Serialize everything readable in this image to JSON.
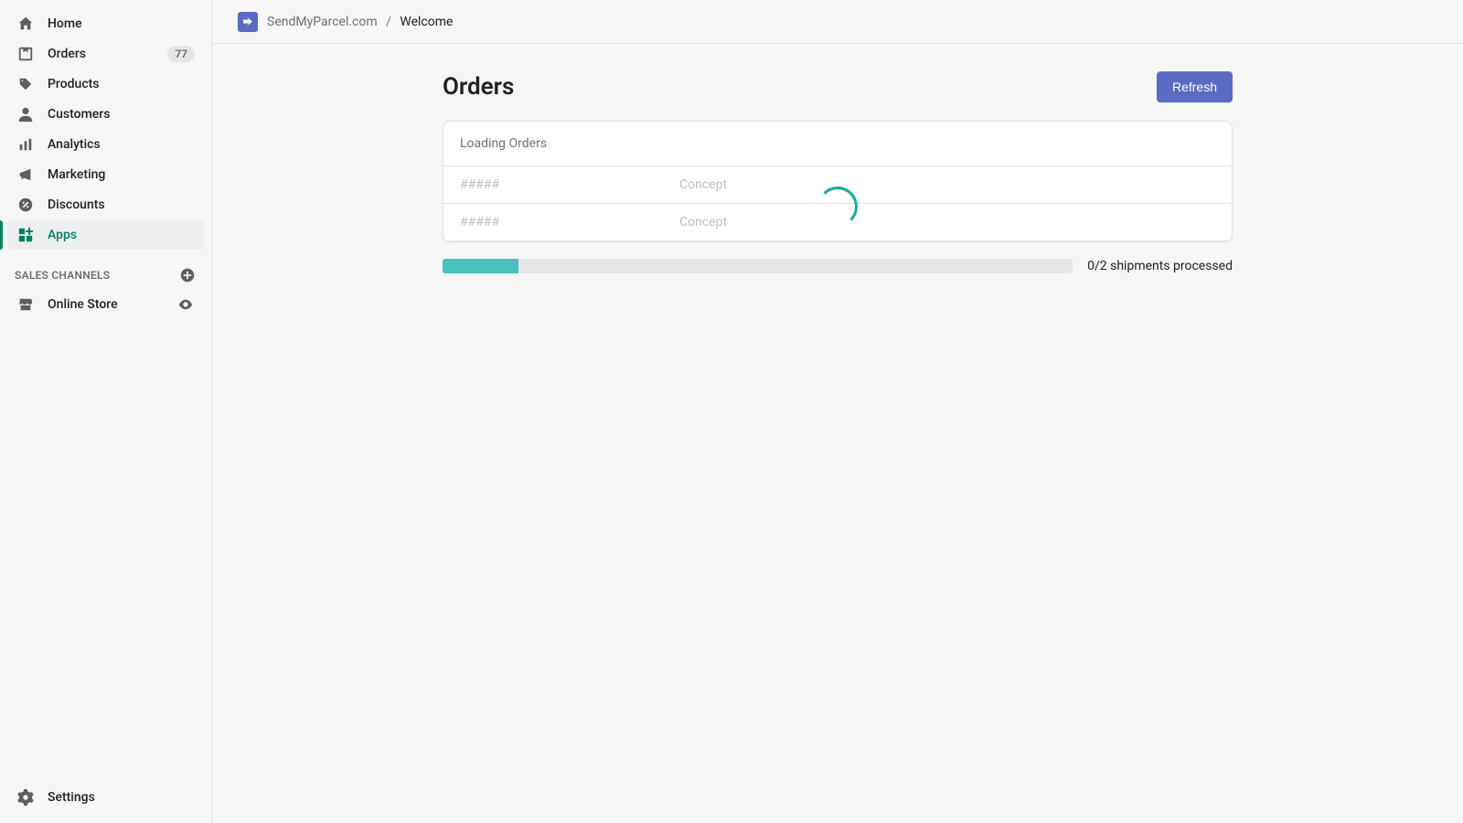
{
  "sidebar": {
    "items": [
      {
        "label": "Home",
        "icon": "home-icon"
      },
      {
        "label": "Orders",
        "icon": "orders-icon",
        "badge": "77"
      },
      {
        "label": "Products",
        "icon": "products-icon"
      },
      {
        "label": "Customers",
        "icon": "customers-icon"
      },
      {
        "label": "Analytics",
        "icon": "analytics-icon"
      },
      {
        "label": "Marketing",
        "icon": "marketing-icon"
      },
      {
        "label": "Discounts",
        "icon": "discounts-icon"
      },
      {
        "label": "Apps",
        "icon": "apps-icon",
        "active": true
      }
    ],
    "sectionHeader": "SALES CHANNELS",
    "channels": [
      {
        "label": "Online Store",
        "icon": "store-icon"
      }
    ],
    "settingsLabel": "Settings"
  },
  "breadcrumb": {
    "app": "SendMyParcel.com",
    "current": "Welcome"
  },
  "page": {
    "title": "Orders",
    "refreshLabel": "Refresh",
    "cardHeader": "Loading Orders",
    "rows": [
      {
        "id": "#####",
        "status": "Concept"
      },
      {
        "id": "#####",
        "status": "Concept"
      }
    ],
    "progress": {
      "processed": 0,
      "total": 2,
      "label": "0/2 shipments processed",
      "percent": 12
    }
  }
}
